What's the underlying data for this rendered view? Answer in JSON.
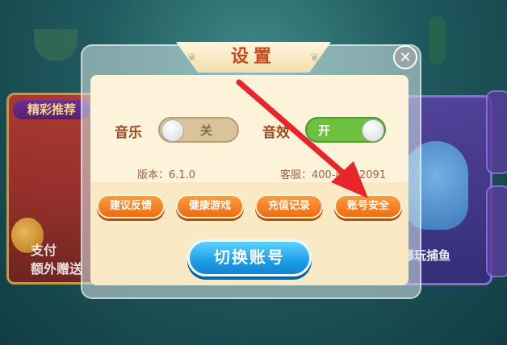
{
  "background": {
    "promo_left": {
      "title": "精彩推荐",
      "line1": "支付",
      "line2": "额外赠送"
    },
    "promo_right": {
      "text": "爆玩捕鱼"
    }
  },
  "dialog": {
    "title": "设置",
    "close_icon": "close-icon",
    "music": {
      "label": "音乐",
      "state": "关",
      "on": false
    },
    "sound": {
      "label": "音效",
      "state": "开",
      "on": true
    },
    "version": "版本：6.1.0",
    "service": "客服：400-885-2091",
    "buttons": [
      "建议反馈",
      "健康游戏",
      "充值记录",
      "账号安全"
    ],
    "switch_account": "切换账号"
  },
  "colors": {
    "title": "#c44a1c",
    "orange_button": "#ef6b12",
    "blue_button": "#1b9ee8",
    "toggle_on": "#6cc23f",
    "arrow": "#e8262a"
  }
}
